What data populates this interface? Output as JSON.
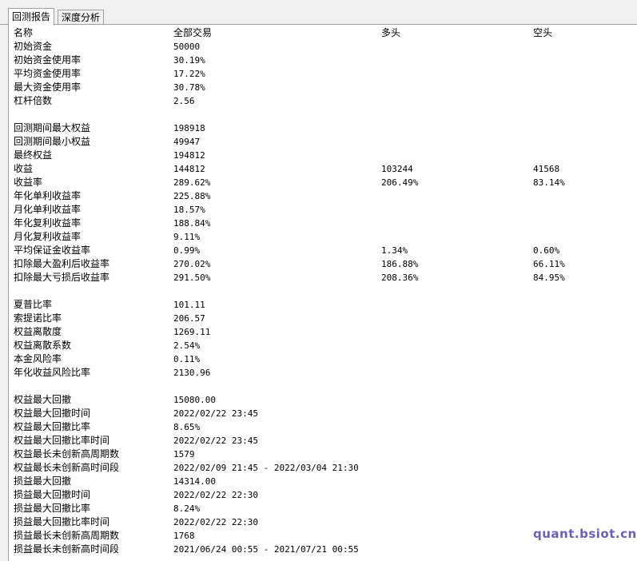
{
  "tabs": [
    "回测报告",
    "深度分析"
  ],
  "columns": [
    "名称",
    "全部交易",
    "多头",
    "空头"
  ],
  "rows": [
    {
      "label": "初始资金",
      "all": "50000",
      "long": "",
      "short": ""
    },
    {
      "label": "初始资金使用率",
      "all": "30.19%",
      "long": "",
      "short": ""
    },
    {
      "label": "平均资金使用率",
      "all": "17.22%",
      "long": "",
      "short": ""
    },
    {
      "label": "最大资金使用率",
      "all": "30.78%",
      "long": "",
      "short": ""
    },
    {
      "label": "杠杆倍数",
      "all": "2.56",
      "long": "",
      "short": ""
    },
    null,
    {
      "label": "回测期间最大权益",
      "all": "198918",
      "long": "",
      "short": ""
    },
    {
      "label": "回测期间最小权益",
      "all": "49947",
      "long": "",
      "short": ""
    },
    {
      "label": "最终权益",
      "all": "194812",
      "long": "",
      "short": ""
    },
    {
      "label": "收益",
      "all": "144812",
      "long": "103244",
      "short": "41568"
    },
    {
      "label": "收益率",
      "all": "289.62%",
      "long": "206.49%",
      "short": "83.14%"
    },
    {
      "label": "年化单利收益率",
      "all": "225.88%",
      "long": "",
      "short": ""
    },
    {
      "label": "月化单利收益率",
      "all": "18.57%",
      "long": "",
      "short": ""
    },
    {
      "label": "年化复利收益率",
      "all": "188.84%",
      "long": "",
      "short": ""
    },
    {
      "label": "月化复利收益率",
      "all": "9.11%",
      "long": "",
      "short": ""
    },
    {
      "label": "平均保证金收益率",
      "all": "0.99%",
      "long": "1.34%",
      "short": "0.60%"
    },
    {
      "label": "扣除最大盈利后收益率",
      "all": "270.02%",
      "long": "186.88%",
      "short": "66.11%"
    },
    {
      "label": "扣除最大亏损后收益率",
      "all": "291.50%",
      "long": "208.36%",
      "short": "84.95%"
    },
    null,
    {
      "label": "夏普比率",
      "all": "101.11",
      "long": "",
      "short": ""
    },
    {
      "label": "索提诺比率",
      "all": "206.57",
      "long": "",
      "short": ""
    },
    {
      "label": "权益离散度",
      "all": "1269.11",
      "long": "",
      "short": ""
    },
    {
      "label": "权益离散系数",
      "all": "2.54%",
      "long": "",
      "short": ""
    },
    {
      "label": "本金风险率",
      "all": "0.11%",
      "long": "",
      "short": ""
    },
    {
      "label": "年化收益风险比率",
      "all": "2130.96",
      "long": "",
      "short": ""
    },
    null,
    {
      "label": "权益最大回撤",
      "all": "15080.00",
      "long": "",
      "short": ""
    },
    {
      "label": "权益最大回撤时间",
      "all": "2022/02/22 23:45",
      "long": "",
      "short": ""
    },
    {
      "label": "权益最大回撤比率",
      "all": "8.65%",
      "long": "",
      "short": ""
    },
    {
      "label": "权益最大回撤比率时间",
      "all": "2022/02/22 23:45",
      "long": "",
      "short": ""
    },
    {
      "label": "权益最长未创新高周期数",
      "all": "1579",
      "long": "",
      "short": ""
    },
    {
      "label": "权益最长未创新高时间段",
      "all": "2022/02/09 21:45 - 2022/03/04 21:30",
      "long": "",
      "short": ""
    },
    {
      "label": "损益最大回撤",
      "all": "14314.00",
      "long": "",
      "short": ""
    },
    {
      "label": "损益最大回撤时间",
      "all": "2022/02/22 22:30",
      "long": "",
      "short": ""
    },
    {
      "label": "损益最大回撤比率",
      "all": "8.24%",
      "long": "",
      "short": ""
    },
    {
      "label": "损益最大回撤比率时间",
      "all": "2022/02/22 22:30",
      "long": "",
      "short": ""
    },
    {
      "label": "损益最长未创新高周期数",
      "all": "1768",
      "long": "",
      "short": ""
    },
    {
      "label": "损益最长未创新高时间段",
      "all": "2021/06/24 00:55 - 2021/07/21 00:55",
      "long": "",
      "short": ""
    }
  ],
  "watermark": "quant.bsiot.cn"
}
